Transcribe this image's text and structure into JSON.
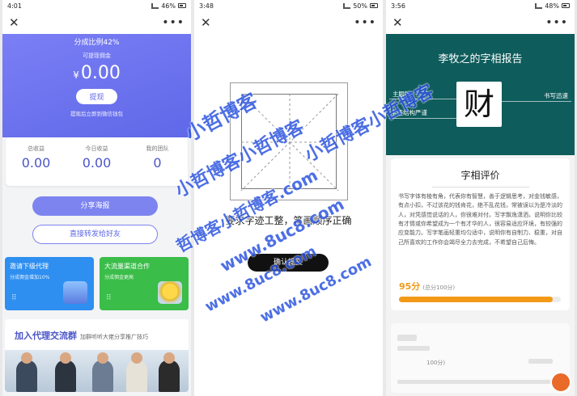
{
  "phone1": {
    "status": {
      "time": "4:01",
      "battery": "46%"
    },
    "hero": {
      "ratio": "分成比例42%",
      "withdrawable_label": "可提现佣金",
      "currency": "¥",
      "amount": "0.00",
      "withdraw_button": "提现",
      "hint": "提现后立即到微信钱包"
    },
    "stats": [
      {
        "label": "总收益",
        "value": "0.00"
      },
      {
        "label": "今日收益",
        "value": "0.00"
      },
      {
        "label": "我的团队",
        "value": "0"
      }
    ],
    "share_button": "分享海报",
    "forward_button": "直接转发给好友",
    "cards": [
      {
        "title": "邀请下级代理",
        "subtitle": "分成佣金增加10%"
      },
      {
        "title": "大流量渠道合作",
        "subtitle": "分成佣金更高"
      }
    ],
    "join": {
      "title": "加入代理交流群",
      "subtitle": "加群听听大佬分享推广技巧"
    }
  },
  "phone2": {
    "status": {
      "time": "3:48",
      "battery": "50%"
    },
    "instruction": "要求字迹工整，笔画顺序正确",
    "confirm_button": "确认提交"
  },
  "phone3": {
    "status": {
      "time": "3:56",
      "battery": "48%"
    },
    "title": "李牧之的字相报告",
    "sample_char": "财",
    "traits": [
      "主観料",
      "书写迅速",
      "字迹结构严谨"
    ],
    "eval_title": "字相评价",
    "eval_text": "书写字体有棱有角，代表你有智慧，善于逻辑思考，对金钱敏感，有点小扣，不过该花的钱肯花，绝不乱花钱，常被误以为是冷淡的人，对凭感觉说话的人，你很难对付。写字飘逸潇洒，说明你比较有才情或你希望成为一个有才华的人，很容易适应环境，有较强的应变能力。写字笔画轻重均匀适中，说明你有自制力、稳重，对自己所喜欢的工作你会竭尽全力去完成，不希望自己后悔。",
    "score": "95分",
    "score_total": "(总分100分)",
    "score_percent": 95,
    "blur_text": "100分)"
  },
  "watermarks": [
    "小哲博客",
    "小哲博客小哲博客",
    "哲博客小哲博客.com",
    "www.8uc8.com",
    "小哲博客小哲博客",
    "www.8uc8.com",
    "www.8uc8.com"
  ],
  "colors": {
    "accent": "#5f68e8",
    "teal": "#0f5c5c",
    "orange": "#f29a17",
    "blue_card": "#2e8ff0",
    "green_card": "#3bbd4a"
  },
  "icons": {
    "close": "close-icon",
    "more": "more-icon"
  }
}
